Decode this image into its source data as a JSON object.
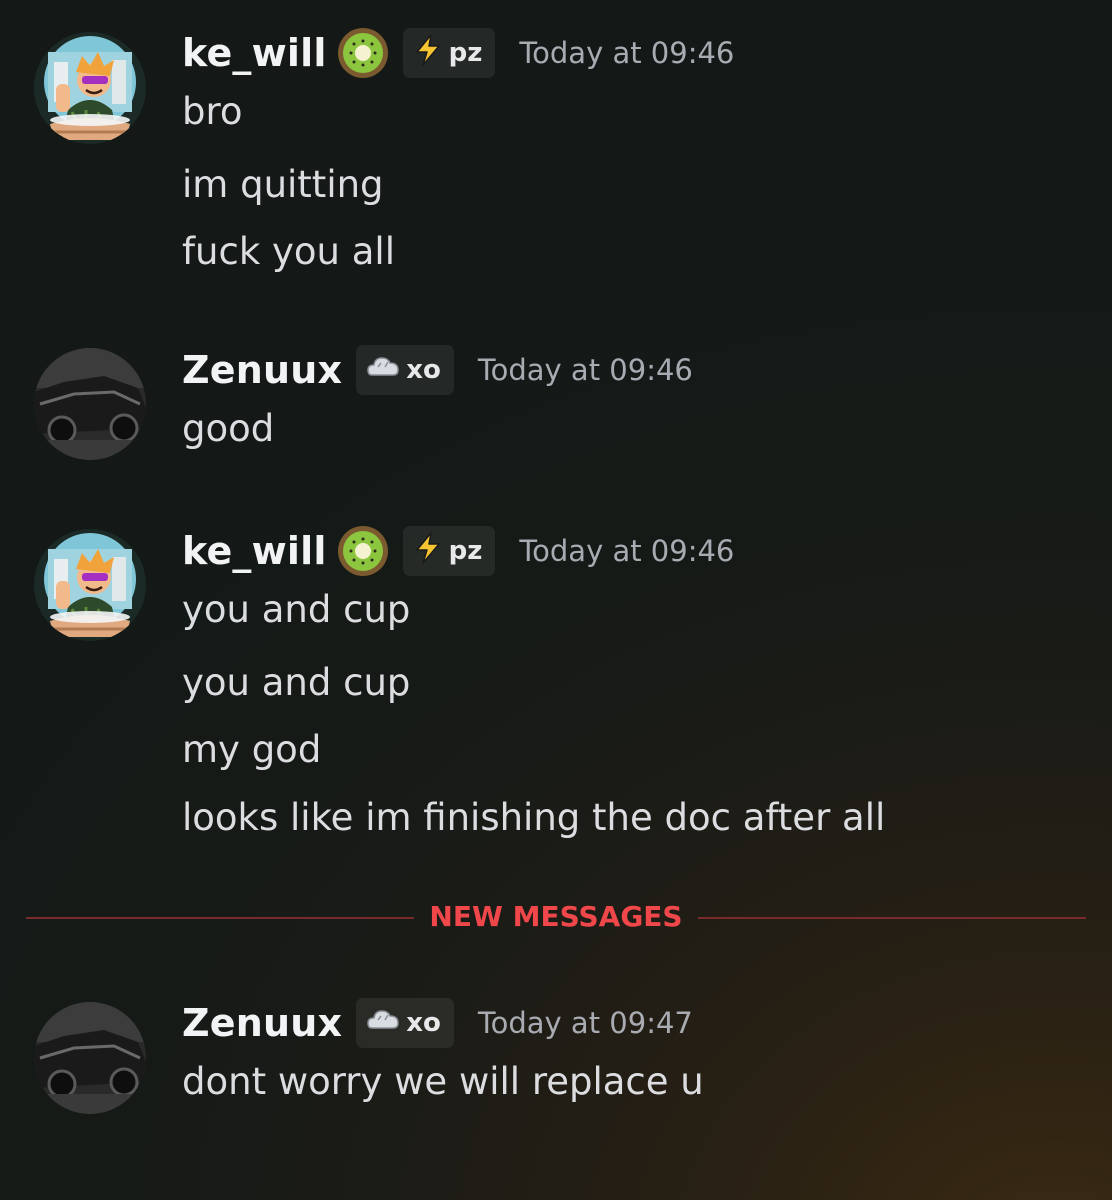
{
  "messages": [
    {
      "username": "ke_will",
      "tag": "pz",
      "timestamp": "Today at 09:46",
      "lines": [
        "bro",
        "im quitting",
        "fuck you all"
      ]
    },
    {
      "username": "Zenuux",
      "tag": "xo",
      "timestamp": "Today at 09:46",
      "lines": [
        "good"
      ]
    },
    {
      "username": "ke_will",
      "tag": "pz",
      "timestamp": "Today at 09:46",
      "lines": [
        "you and cup",
        "you and cup",
        "my god",
        "looks like im finishing the doc after all"
      ]
    },
    {
      "username": "Zenuux",
      "tag": "xo",
      "timestamp": "Today at 09:47",
      "lines": [
        "dont worry we will replace u"
      ]
    }
  ],
  "divider": {
    "label": "NEW MESSAGES",
    "color": "#f0474a"
  },
  "icons": {
    "kewill_badge": "kiwi-icon",
    "kewill_tag": "lightning-icon",
    "zenuux_tag": "cloud-icon"
  }
}
